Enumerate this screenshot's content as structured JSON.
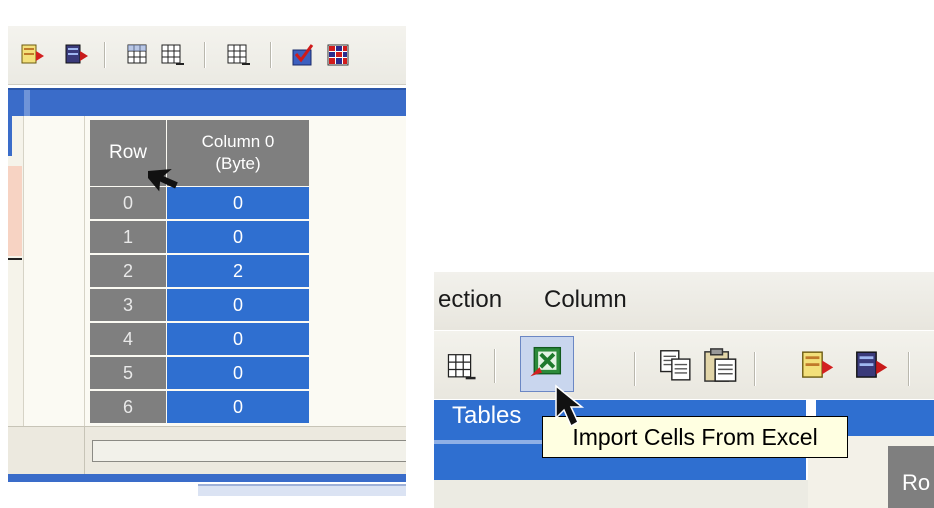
{
  "left_panel": {
    "grid": {
      "row_header": "Row",
      "column_header_line1": "Column 0",
      "column_header_line2": "(Byte)",
      "rows": [
        {
          "row": "0",
          "value": "0"
        },
        {
          "row": "1",
          "value": "0"
        },
        {
          "row": "2",
          "value": "2"
        },
        {
          "row": "3",
          "value": "0"
        },
        {
          "row": "4",
          "value": "0"
        },
        {
          "row": "5",
          "value": "0"
        },
        {
          "row": "6",
          "value": "0"
        }
      ]
    },
    "toolbar_icons": [
      "export-arrow-icon",
      "import-arrow-icon",
      "grid-icon",
      "grid-add-icon",
      "grid-edit-icon",
      "check-grid-icon",
      "color-grid-icon"
    ]
  },
  "right_panel": {
    "menu": {
      "section_label": "ection",
      "column_label": "Column"
    },
    "tables_label": "Tables",
    "tooltip": "Import Cells From Excel",
    "toolbar_icons": [
      "grid-add-icon",
      "import-excel-icon",
      "export-excel-icon",
      "copy-icon",
      "paste-icon",
      "export-arrow-icon",
      "import-arrow-icon"
    ],
    "grid_corner_text": "Ro"
  },
  "colors": {
    "selection_blue": "#2f6fd0",
    "header_gray": "#7f7f7f",
    "tooltip_bg": "#ffffe1"
  }
}
